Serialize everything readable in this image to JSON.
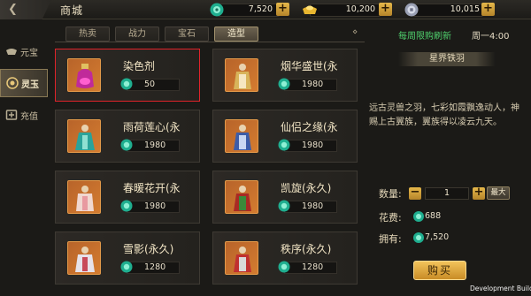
{
  "header": {
    "title": "商城",
    "currencies": [
      {
        "icon": "jade-coin-icon",
        "value": "7,520"
      },
      {
        "icon": "gold-ingot-icon",
        "value": "10,200"
      },
      {
        "icon": "silver-coin-icon",
        "value": "10,015"
      }
    ]
  },
  "sidebar": {
    "items": [
      {
        "label": "元宝",
        "icon": "ingot-icon"
      },
      {
        "label": "灵玉",
        "icon": "spirit-jade-icon"
      },
      {
        "label": "充值",
        "icon": "recharge-icon"
      }
    ],
    "active_index": 1
  },
  "tabs": [
    {
      "label": "热卖"
    },
    {
      "label": "战力"
    },
    {
      "label": "宝石"
    },
    {
      "label": "造型"
    }
  ],
  "active_tab_index": 3,
  "refresh": {
    "text": "每周限购刷新",
    "time": "周一4:00"
  },
  "items": [
    {
      "name": "染色剂",
      "price": "50",
      "selected": true
    },
    {
      "name": "烟华盛世(永",
      "price": "1980"
    },
    {
      "name": "雨荷莲心(永",
      "price": "1980"
    },
    {
      "name": "仙侣之缘(永",
      "price": "1980"
    },
    {
      "name": "春暖花开(永",
      "price": "1980"
    },
    {
      "name": "凯旋(永久)",
      "price": "1980"
    },
    {
      "name": "雪影(永久)",
      "price": "1280"
    },
    {
      "name": "秩序(永久)",
      "price": "1280"
    }
  ],
  "detail": {
    "title": "星界铁羽",
    "description": "远古灵兽之羽，七彩如霞飘逸动人，神赐上古翼族，翼族得以凌云九天。",
    "quantity_label": "数量:",
    "quantity": "1",
    "max_label": "最大",
    "cost_label": "花费:",
    "cost": "688",
    "owned_label": "拥有:",
    "owned": "7,520",
    "buy_label": "购买"
  },
  "dev_build": "Development Build",
  "colors": {
    "accent_gold": "#e6b84a",
    "refresh_green": "#4fd06d",
    "selected_red": "#e0232a"
  }
}
